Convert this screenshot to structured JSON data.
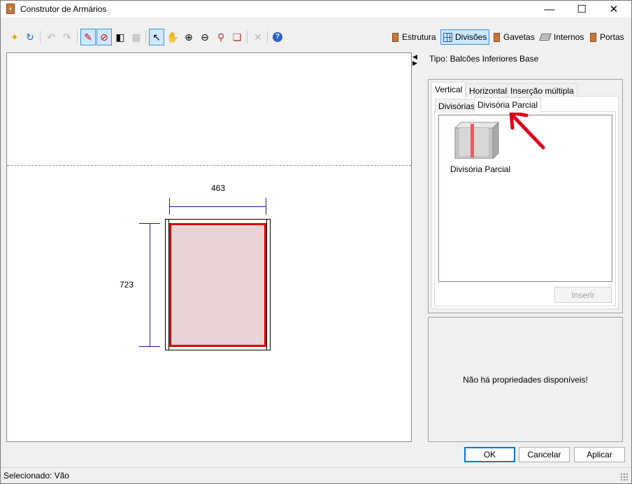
{
  "window": {
    "title": "Construtor de Armários"
  },
  "toolbar": {
    "modes": [
      {
        "label": "Estrutura",
        "icon": "cabinet-icon"
      },
      {
        "label": "Divisões",
        "icon": "grid-icon",
        "active": true
      },
      {
        "label": "Gavetas",
        "icon": "drawer-icon"
      },
      {
        "label": "Internos",
        "icon": "shelf-icon"
      },
      {
        "label": "Portas",
        "icon": "door-icon"
      }
    ]
  },
  "canvas": {
    "width_dim": "463",
    "height_dim": "723"
  },
  "panel": {
    "tipo": "Tipo: Balcões Inferiores Base",
    "tabs": [
      "Vertical",
      "Horizontal",
      "Inserção múltipla"
    ],
    "subtabs": [
      "Divisórias",
      "Divisória Parcial"
    ],
    "item_label": "Divisória Parcial",
    "insert_button": "Inserir",
    "no_properties": "Não há propriedades disponíveis!"
  },
  "buttons": {
    "ok": "OK",
    "cancel": "Cancelar",
    "apply": "Aplicar"
  },
  "status": {
    "text": "Selecionado: Vão"
  },
  "colors": {
    "selection": "#e00000",
    "dimension": "#1a1aa0",
    "active_tab": "#cce8ff"
  }
}
